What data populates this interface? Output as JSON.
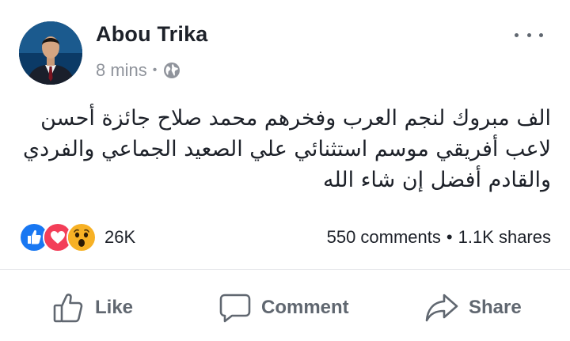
{
  "post": {
    "author": "Abou Trika",
    "timestamp": "8 mins",
    "meta_separator": "•",
    "text_lines": [
      "الف مبروك لنجم العرب وفخرهم محمد صلاح جائزة أحسن",
      "لاعب أفريقي موسم استثنائي علي الصعيد الجماعي والفردي",
      "والقادم أفضل إن شاء الله"
    ],
    "privacy_icon": "globe-icon",
    "more_icon": "more-options-icon"
  },
  "engagement": {
    "reaction_icons": [
      "like-reaction-icon",
      "love-reaction-icon",
      "wow-reaction-icon"
    ],
    "reaction_count": "26K",
    "comments": "550 comments",
    "separator": "•",
    "shares": "1.1K shares"
  },
  "actions": {
    "like": "Like",
    "comment": "Comment",
    "share": "Share"
  },
  "colors": {
    "text": "#1d2129",
    "muted": "#90949c",
    "action": "#606770",
    "like_blue": "#1877f2",
    "love_red": "#f33e58",
    "wow_yellow": "#f7b125"
  }
}
